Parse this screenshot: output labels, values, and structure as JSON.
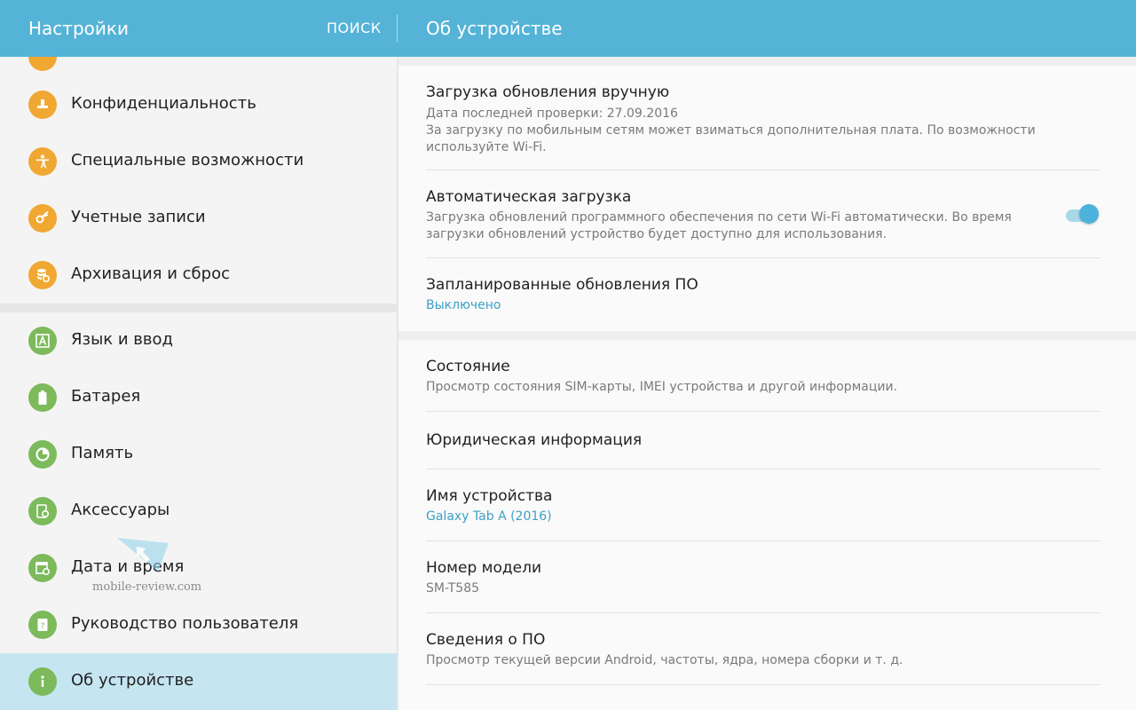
{
  "appbar": {
    "title_left": "Настройки",
    "search": "ПОИСК",
    "title_right": "Об устройстве",
    "color": "#54b3d6"
  },
  "sidebar": {
    "items": [
      {
        "label": "Конфиденциальность",
        "icon": "privacy-icon",
        "color": "#f0a833"
      },
      {
        "label": "Специальные возможности",
        "icon": "accessibility-icon",
        "color": "#f0a833"
      },
      {
        "label": "Учетные записи",
        "icon": "key-icon",
        "color": "#f0a833"
      },
      {
        "label": "Архивация и сброс",
        "icon": "backup-icon",
        "color": "#f0a833"
      },
      {
        "label": "Язык и ввод",
        "icon": "language-icon",
        "color": "#7cba5c"
      },
      {
        "label": "Батарея",
        "icon": "battery-icon",
        "color": "#7cba5c"
      },
      {
        "label": "Память",
        "icon": "memory-icon",
        "color": "#7cba5c"
      },
      {
        "label": "Аксессуары",
        "icon": "accessories-icon",
        "color": "#7cba5c"
      },
      {
        "label": "Дата и время",
        "icon": "calendar-icon",
        "color": "#7cba5c"
      },
      {
        "label": "Руководство пользователя",
        "icon": "manual-icon",
        "color": "#7cba5c"
      },
      {
        "label": "Об устройстве",
        "icon": "info-icon",
        "color": "#7cba5c",
        "selected": true
      }
    ]
  },
  "content": {
    "manual_update": {
      "title": "Загрузка обновления вручную",
      "line1": "Дата последней проверки: 27.09.2016",
      "line2": "За загрузку по мобильным сетям может взиматься дополнительная плата. По возможности используйте Wi-Fi."
    },
    "auto_download": {
      "title": "Автоматическая загрузка",
      "summary": "Загрузка обновлений программного обеспечения по сети Wi-Fi автоматически. Во время загрузки обновлений устройство будет доступно для использования.",
      "enabled": true
    },
    "scheduled": {
      "title": "Запланированные обновления ПО",
      "value": "Выключено"
    },
    "status": {
      "title": "Состояние",
      "summary": "Просмотр состояния SIM-карты, IMEI устройства и другой информации."
    },
    "legal": {
      "title": "Юридическая информация"
    },
    "device_name": {
      "title": "Имя устройства",
      "value": "Galaxy Tab A (2016)"
    },
    "model": {
      "title": "Номер модели",
      "value": "SM-T585"
    },
    "software": {
      "title": "Сведения о ПО",
      "summary": "Просмотр текущей версии Android, частоты, ядра, номера сборки и т. д."
    }
  },
  "watermark": {
    "text": "mobile-review.com"
  }
}
